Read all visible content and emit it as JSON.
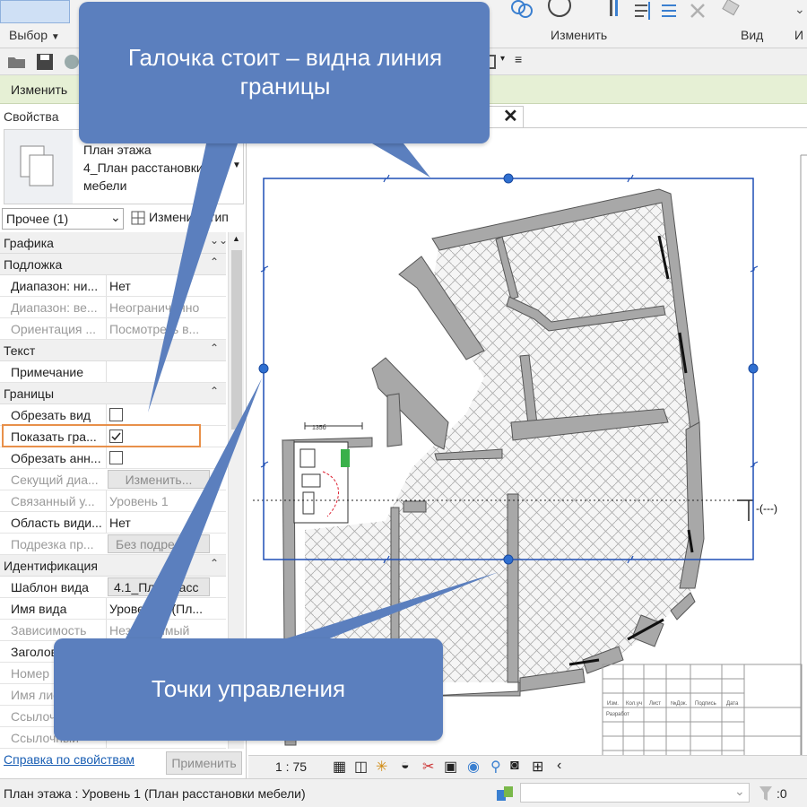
{
  "ribbon": {
    "select_label": "Выбор",
    "modify_label": "Изменить",
    "view_label": "Вид",
    "trailing_label": "И"
  },
  "context_bar": {
    "label": "Изменить"
  },
  "properties": {
    "title": "Свойства",
    "family_line1": "План этажа",
    "family_line2": "4_План расстановки",
    "family_line3": "мебели",
    "instance_selector": "Прочее (1)",
    "edit_type": "Изменить тип",
    "groups": {
      "graphics": "Графика",
      "underlay": "Подложка",
      "text": "Текст",
      "extents": "Границы",
      "identity": "Идентификация"
    },
    "rows": {
      "range_base_k": "Диапазон: ни...",
      "range_base_v": "Нет",
      "range_top_k": "Диапазон: ве...",
      "range_top_v": "Неограниченно",
      "orientation_k": "Ориентация ...",
      "orientation_v": "Посмотреть в...",
      "note_k": "Примечание",
      "crop_view_k": "Обрезать вид",
      "show_crop_k": "Показать гра...",
      "crop_annot_k": "Обрезать анн...",
      "section_box_k": "Секущий диа...",
      "section_box_v": "Изменить...",
      "linked_level_k": "Связанный у...",
      "linked_level_v": "Уровень 1",
      "scope_box_k": "Область види...",
      "scope_box_v": "Нет",
      "depth_clip_k": "Подрезка пр...",
      "depth_clip_v": "Без подре...",
      "view_template_k": "Шаблон вида",
      "view_template_v": "4.1_План расс",
      "view_name_k": "Имя вида",
      "view_name_v": "Уровень 1 (Пл...",
      "dependency_k": "Зависимость",
      "dependency_v": "Независимый",
      "title_on_sheet_k": "Заголовок",
      "sheet_number_k": "Номер",
      "sheet_name_k": "Имя листа",
      "ref_sheet_k": "Ссылочный",
      "ref_detail_k": "Ссылочный"
    },
    "help_link": "Справка по свойствам",
    "apply_button": "Применить"
  },
  "view": {
    "tab_suffix": "...",
    "scale": "1 : 75",
    "section_tag": "-(---)",
    "dim_label": "135б"
  },
  "titleblock": {
    "cols": [
      "Изм.",
      "Кол.уч",
      "Лист",
      "№Док.",
      "Подпись",
      "Дата"
    ],
    "row2": "Разработ"
  },
  "status_bar": {
    "text": "План этажа : Уровень 1 (План расстановки мебели)",
    "counter": ":0"
  },
  "callouts": {
    "top": "Галочка стоит –  видна линия границы",
    "bottom": "Точки управления"
  },
  "colors": {
    "callout": "#5b7fbe",
    "crop_line": "#1f4fb5",
    "context_bar": "#e6f0d5",
    "highlight": "#e8904a"
  }
}
